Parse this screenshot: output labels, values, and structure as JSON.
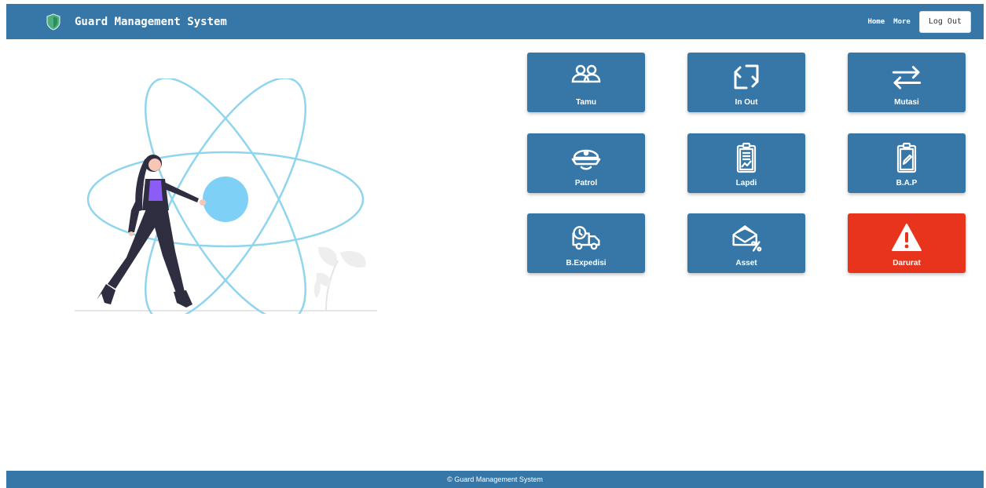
{
  "header": {
    "title": "Guard Management System",
    "logo_icon": "shield-icon",
    "nav": {
      "home": "Home",
      "more": "More",
      "logout": "Log Out"
    }
  },
  "tiles": [
    {
      "label": "Tamu",
      "icon": "users-icon"
    },
    {
      "label": "In Out",
      "icon": "repeat-icon"
    },
    {
      "label": "Mutasi",
      "icon": "swap-arrows-icon"
    },
    {
      "label": "Patrol",
      "icon": "guard-cap-icon"
    },
    {
      "label": "Lapdi",
      "icon": "clipboard-chart-icon"
    },
    {
      "label": "B.A.P",
      "icon": "clipboard-edit-icon"
    },
    {
      "label": "B.Expedisi",
      "icon": "delivery-truck-icon"
    },
    {
      "label": "Asset",
      "icon": "envelope-percent-icon"
    },
    {
      "label": "Darurat",
      "icon": "warning-icon"
    }
  ],
  "footer": {
    "text": "© Guard Management System"
  },
  "colors": {
    "primary": "#3677a8",
    "danger": "#e8341c",
    "accent_orbit": "#90d5ee",
    "accent_nucleus": "#7ed0f6",
    "figure_top": "#8b5cf6"
  }
}
